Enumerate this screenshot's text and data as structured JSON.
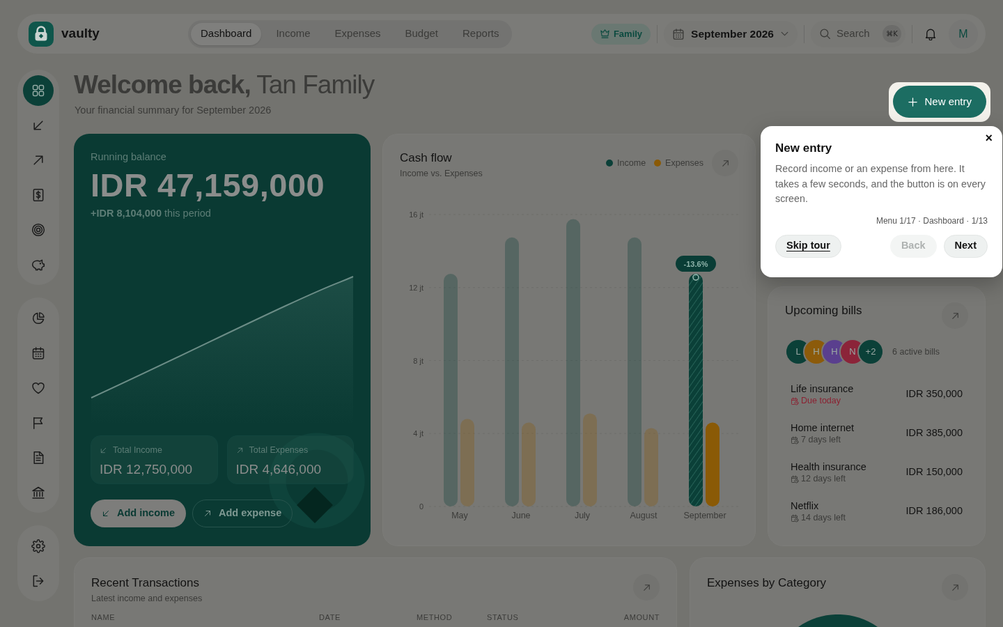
{
  "topbar": {
    "logo": "vaulty",
    "nav": [
      {
        "label": "Dashboard",
        "selected": true
      },
      {
        "label": "Income",
        "selected": false
      },
      {
        "label": "Expenses",
        "selected": false
      },
      {
        "label": "Budget",
        "selected": false
      },
      {
        "label": "Reports",
        "selected": false
      }
    ],
    "plan": "Family",
    "period": "September 2026",
    "search": {
      "placeholder": "Search",
      "shortcut": "⌘K"
    },
    "avatar": "M"
  },
  "sidebar": {
    "groups": [
      {
        "items": [
          {
            "selected": true
          },
          {
            "selected": false
          },
          {
            "selected": false
          },
          {
            "selected": false
          },
          {
            "selected": false
          },
          {
            "selected": false
          }
        ]
      },
      {
        "items": [
          {
            "selected": false
          },
          {
            "selected": false
          },
          {
            "selected": false
          },
          {
            "selected": false
          },
          {
            "selected": false
          },
          {
            "selected": false
          }
        ]
      },
      {
        "items": [
          {
            "selected": false
          },
          {
            "selected": false
          }
        ]
      }
    ]
  },
  "header": {
    "title": "**Welcome back,** Tan Family",
    "subtitle": "Your financial summary for September 2026",
    "new_entry": {
      "label": "New entry",
      "spotlight": true
    }
  },
  "balance": {
    "label": "Running balance",
    "amount": "IDR 47,159,000",
    "change": "**+IDR 8,104,000** this period",
    "stats": [
      {
        "kind": "income",
        "label": "Total Income",
        "value": "IDR 12,750,000"
      },
      {
        "kind": "expense",
        "label": "Total Expenses",
        "value": "IDR 4,646,000"
      }
    ],
    "actions": [
      {
        "kind": "income",
        "label": "Add income"
      },
      {
        "kind": "expense",
        "label": "Add expense"
      }
    ]
  },
  "cash_flow": {
    "title": "Cash flow",
    "subtitle": "Income vs. Expenses",
    "chart_data": {
      "type": "bar",
      "categories": [
        "May",
        "June",
        "July",
        "August",
        "September"
      ],
      "series": [
        {
          "name": "Income",
          "color": "#0b4038",
          "values": [
            12.75,
            14.75,
            15.75,
            14.75,
            12.75
          ]
        },
        {
          "name": "Expenses",
          "color": "#8a5a06",
          "values": [
            4.8,
            4.6,
            5.1,
            4.3,
            4.6
          ]
        }
      ],
      "ylim": [
        0,
        16
      ],
      "yticks": [
        {
          "value": 0,
          "label": "0"
        },
        {
          "value": 4,
          "label": "4 jt"
        },
        {
          "value": 8,
          "label": "8 jt"
        },
        {
          "value": 12,
          "label": "12 jt"
        },
        {
          "value": 16,
          "label": "16 jt"
        }
      ],
      "grid": true,
      "annotations": [
        {
          "x": "September",
          "y": 12.75,
          "text": "-13.6%"
        }
      ]
    }
  },
  "tour": {
    "close": "×",
    "title": "New entry",
    "body": "Record income or an expense from here. It takes a few seconds, and the button is on every screen.",
    "progress": "Menu 1/17 · Dashboard · 1/13",
    "actions": [
      {
        "kind": "skip",
        "label": "Skip tour",
        "disabled": false
      },
      {
        "kind": "back",
        "label": "Back",
        "disabled": true
      },
      {
        "kind": "next",
        "label": "Next",
        "disabled": false
      }
    ]
  },
  "bills": {
    "title": "Upcoming bills",
    "avatars": [
      {
        "initial": "L",
        "color": "#0b4038"
      },
      {
        "initial": "H",
        "color": "#8c5b0b"
      },
      {
        "initial": "H",
        "color": "#5a3f8e"
      },
      {
        "initial": "N",
        "color": "#8b2439"
      },
      {
        "initial": "+2",
        "color": "#0b4038"
      }
    ],
    "count": "6 active bills",
    "items": [
      {
        "name": "Life insurance",
        "due": "Due today",
        "urgent": true,
        "amount": "IDR 350,000"
      },
      {
        "name": "Home internet",
        "due": "7 days left",
        "urgent": false,
        "amount": "IDR 385,000"
      },
      {
        "name": "Health insurance",
        "due": "12 days left",
        "urgent": false,
        "amount": "IDR 150,000"
      },
      {
        "name": "Netflix",
        "due": "14 days left",
        "urgent": false,
        "amount": "IDR 186,000"
      }
    ]
  },
  "transactions": {
    "title": "Recent Transactions",
    "subtitle": "Latest income and expenses",
    "columns": [
      "NAME",
      "DATE",
      "METHOD",
      "STATUS",
      "AMOUNT"
    ]
  },
  "categories": {
    "title": "Expenses by Category"
  }
}
